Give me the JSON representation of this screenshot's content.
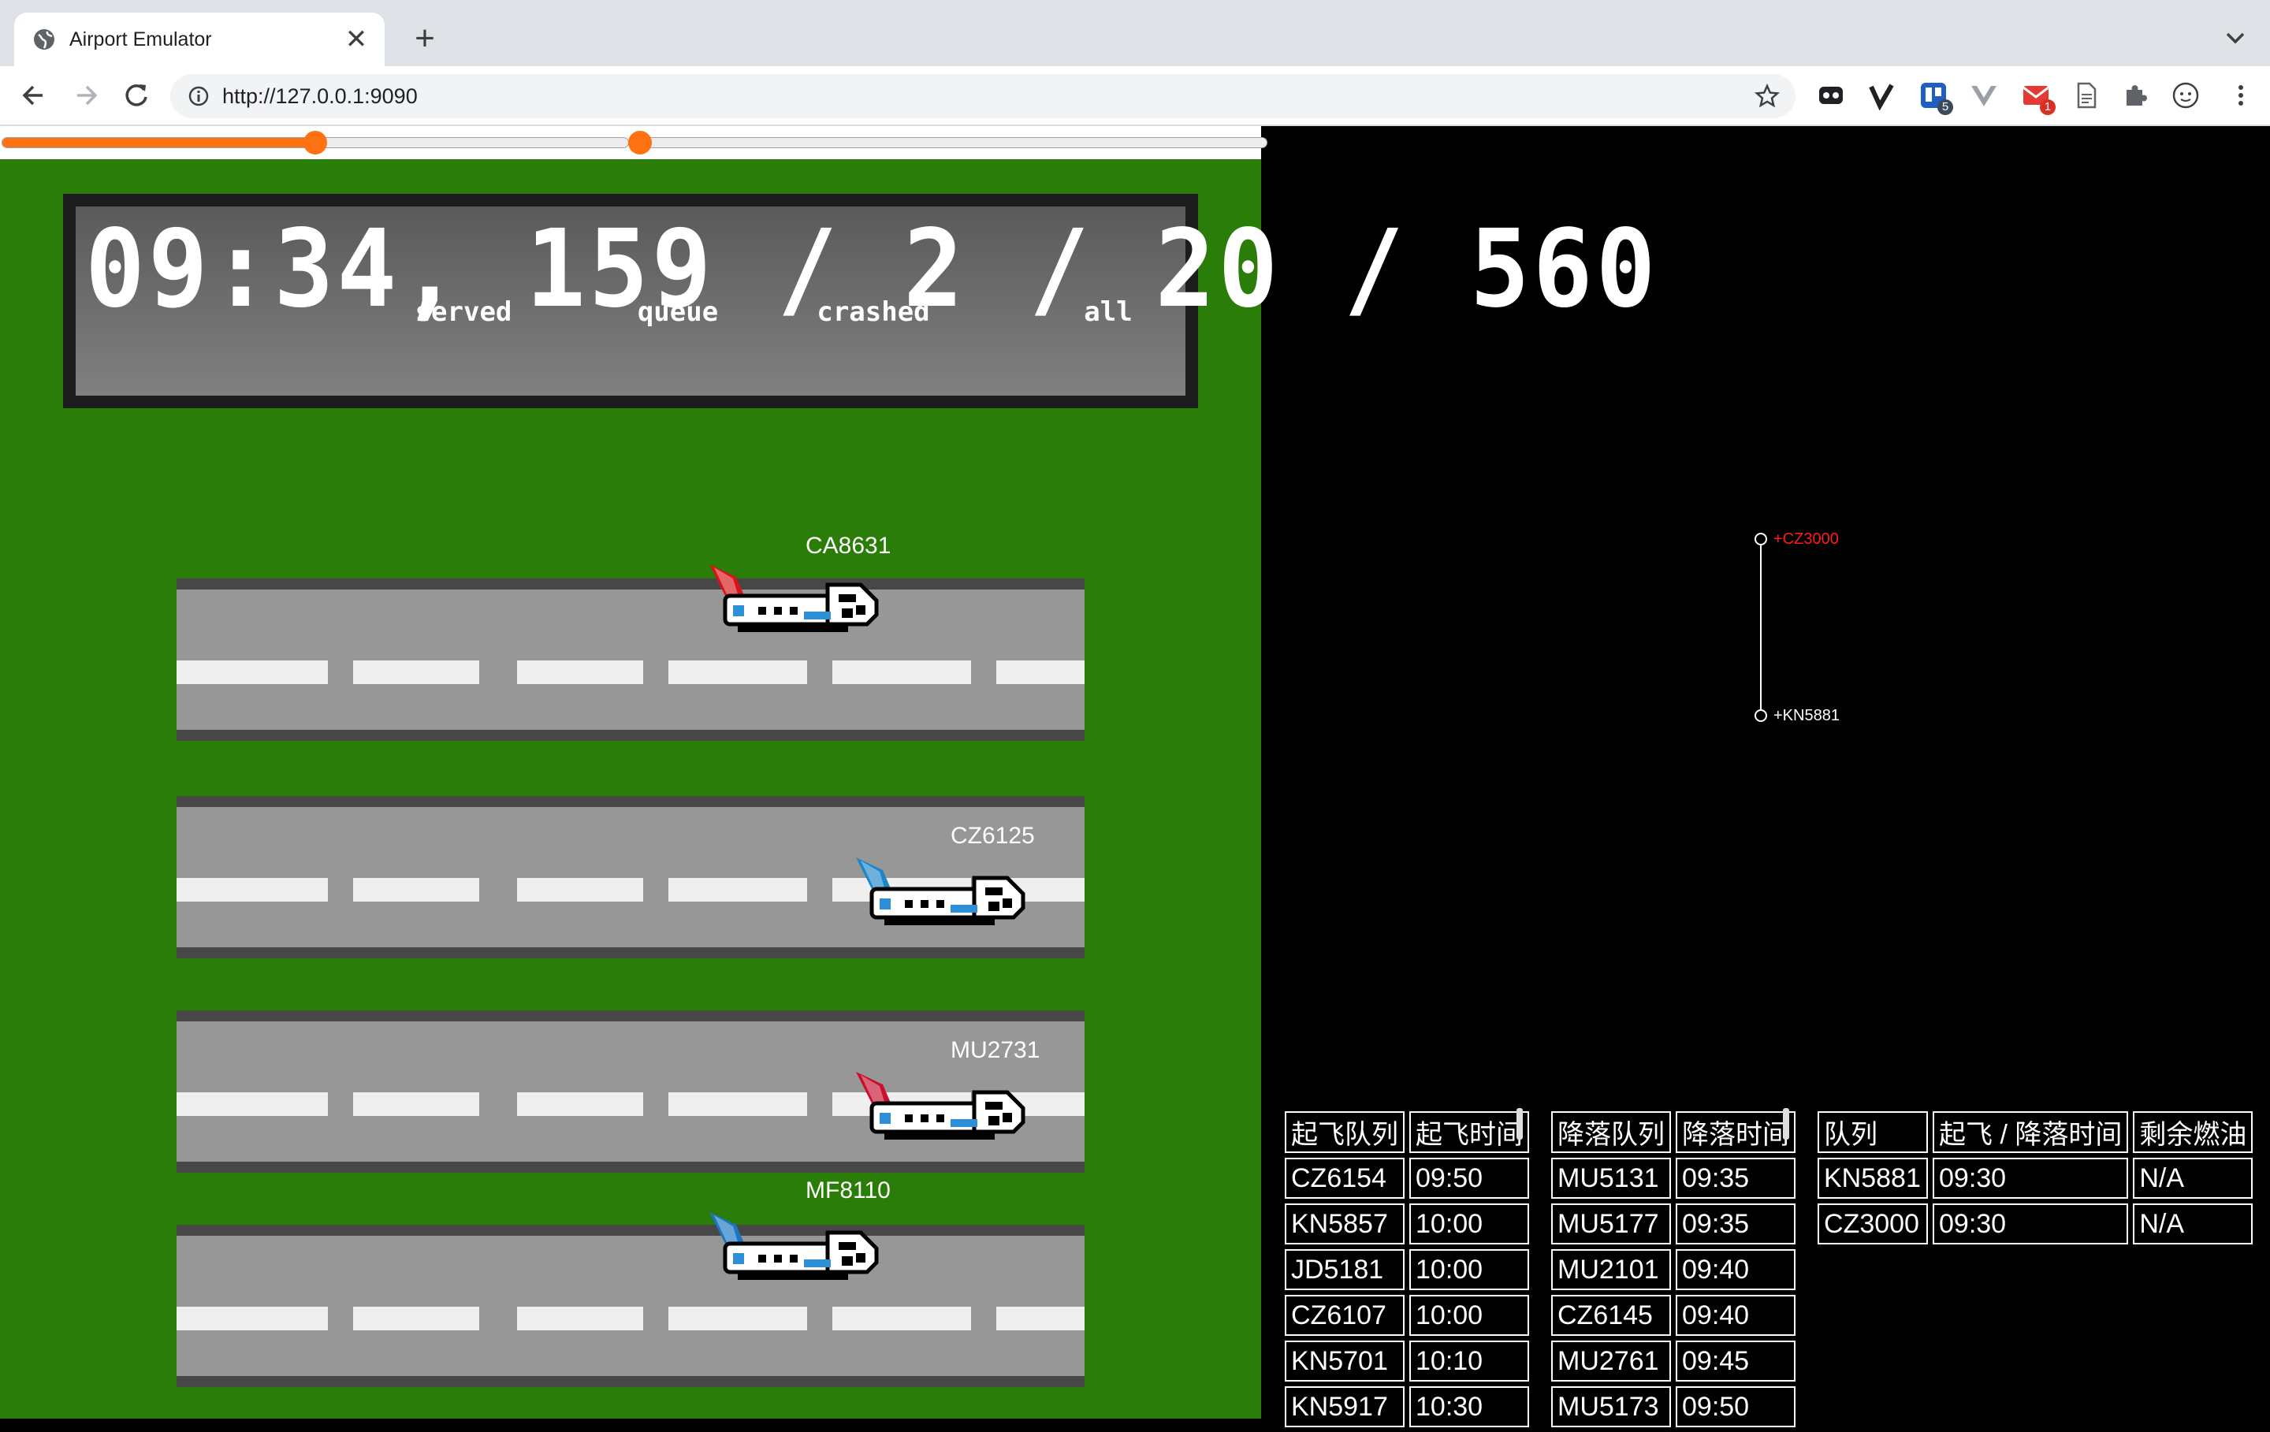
{
  "browser": {
    "tab_title": "Airport Emulator",
    "tab_close": "✕",
    "new_tab": "+",
    "url": "http://127.0.0.1:9090",
    "extension_badges": [
      "5",
      "1"
    ]
  },
  "controls": {
    "speed_slider_value": 0.5,
    "second_slider_value": 0.0
  },
  "scoreboard": {
    "text": "09:34, 159 / 2 / 20 / 560",
    "labels": {
      "served": "served",
      "queue": "queue",
      "crashed": "crashed",
      "all": "all"
    }
  },
  "runways": [
    {
      "flight": "CA8631",
      "airline_color": "#d7141a"
    },
    {
      "flight": "CZ6125",
      "airline_color": "#1e86c8"
    },
    {
      "flight": "MU2731",
      "airline_color": "#c8102e"
    },
    {
      "flight": "MF8110",
      "airline_color": "#1b76c4"
    }
  ],
  "diagram": {
    "top_node": "+CZ3000",
    "top_node_color": "#ff1a1a",
    "bottom_node": "+KN5881"
  },
  "takeoff_table": {
    "headers": [
      "起飞队列",
      "起飞时间"
    ],
    "rows": [
      [
        "CZ6154",
        "09:50"
      ],
      [
        "KN5857",
        "10:00"
      ],
      [
        "JD5181",
        "10:00"
      ],
      [
        "CZ6107",
        "10:00"
      ],
      [
        "KN5701",
        "10:10"
      ],
      [
        "KN5917",
        "10:30"
      ]
    ]
  },
  "landing_table": {
    "headers": [
      "降落队列",
      "降落时间"
    ],
    "rows": [
      [
        "MU5131",
        "09:35"
      ],
      [
        "MU5177",
        "09:35"
      ],
      [
        "MU2101",
        "09:40"
      ],
      [
        "CZ6145",
        "09:40"
      ],
      [
        "MU2761",
        "09:45"
      ],
      [
        "MU5173",
        "09:50"
      ]
    ]
  },
  "queue_table": {
    "headers": [
      "队列",
      "起飞 / 降落时间",
      "剩余燃油"
    ],
    "rows": [
      [
        "KN5881",
        "09:30",
        "N/A"
      ],
      [
        "CZ3000",
        "09:30",
        "N/A"
      ]
    ]
  }
}
